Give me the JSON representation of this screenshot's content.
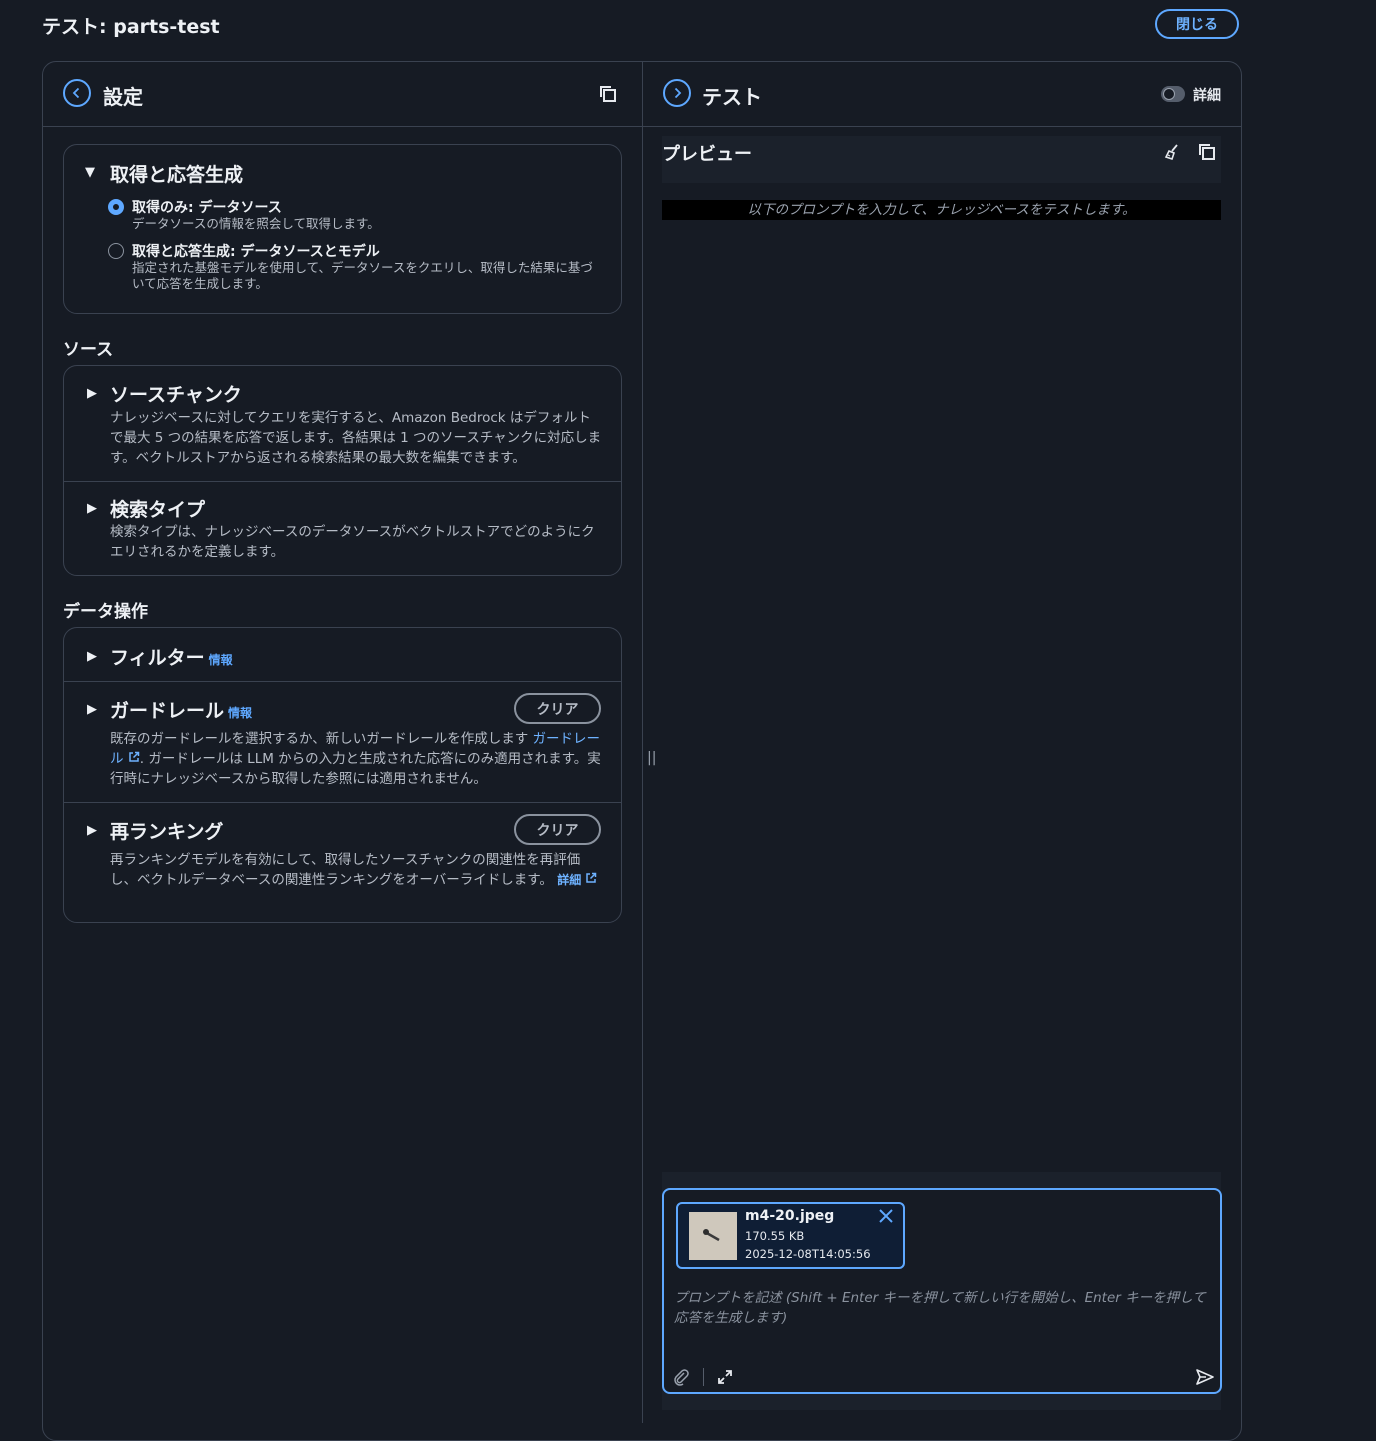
{
  "page": {
    "title": "テスト: parts-test",
    "close_label": "閉じる"
  },
  "left_panel": {
    "title": "設定",
    "retrieval": {
      "title": "取得と応答生成",
      "options": [
        {
          "label": "取得のみ: データソース",
          "desc": "データソースの情報を照会して取得します。",
          "selected": true
        },
        {
          "label": "取得と応答生成: データソースとモデル",
          "desc": "指定された基盤モデルを使用して、データソースをクエリし、取得した結果に基づいて応答を生成します。",
          "selected": false
        }
      ]
    },
    "source_group": {
      "label": "ソース",
      "chunks": {
        "title": "ソースチャンク",
        "desc": "ナレッジベースに対してクエリを実行すると、Amazon Bedrock はデフォルトで最大 5 つの結果を応答で返します。各結果は 1 つのソースチャンクに対応します。ベクトルストアから返される検索結果の最大数を編集できます。"
      },
      "search_type": {
        "title": "検索タイプ",
        "desc": "検索タイプは、ナレッジベースのデータソースがベクトルストアでどのようにクエリされるかを定義します。"
      }
    },
    "data_ops_group": {
      "label": "データ操作",
      "filter": {
        "title": "フィルター",
        "info": "情報"
      },
      "guardrail": {
        "title": "ガードレール",
        "info": "情報",
        "clear": "クリア",
        "desc_pre": "既存のガードレールを選択するか、新しいガードレールを作成します",
        "link": "ガードレール",
        "desc_post": ". ガードレールは LLM からの入力と生成された応答にのみ適用されます。実行時にナレッジベースから取得した参照には適用されません。"
      },
      "reranking": {
        "title": "再ランキング",
        "clear": "クリア",
        "desc": "再ランキングモデルを有効にして、取得したソースチャンクの関連性を再評価し、ベクトルデータベースの関連性ランキングをオーバーライドします。",
        "link": "詳細"
      }
    }
  },
  "right_panel": {
    "title": "テスト",
    "toggle_label": "詳細",
    "toggle_on": false,
    "preview": {
      "title": "プレビュー",
      "hint": "以下のプロンプトを入力して、ナレッジベースをテストします。"
    },
    "composer": {
      "placeholder": "プロンプトを記述 (Shift + Enter キーを押して新しい行を開始し、Enter キーを押して応答を生成します)",
      "attachment": {
        "name": "m4-20.jpeg",
        "size": "170.55 KB",
        "date": "2025-12-08T14:05:56"
      }
    }
  },
  "colors": {
    "background": "#161b24",
    "accent": "#5ea8ff",
    "border": "#3a4250"
  }
}
